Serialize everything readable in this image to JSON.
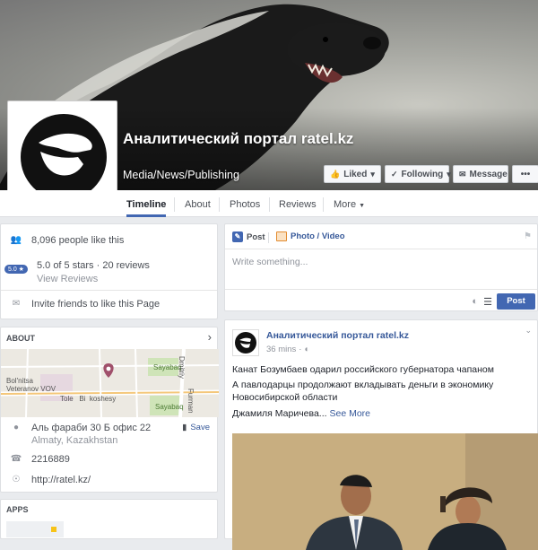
{
  "page": {
    "name": "Аналитический портал ratel.kz",
    "category": "Media/News/Publishing"
  },
  "cover_buttons": {
    "liked": "Liked",
    "following": "Following",
    "message": "Message",
    "more": "•••"
  },
  "tabs": [
    "Timeline",
    "About",
    "Photos",
    "Reviews",
    "More"
  ],
  "stats": {
    "likes": "8,096 people like this",
    "rating_badge": "5.0",
    "rating": "5.0 of 5 stars · 20 reviews",
    "view_reviews": "View Reviews",
    "invite": "Invite friends to like this Page"
  },
  "about": {
    "title": "ABOUT",
    "address_line1": "Аль фараби 30 Б офис 22",
    "address_line2": "Almaty, Kazakhstan",
    "save": "Save",
    "phone": "2216889",
    "website": "http://ratel.kz/",
    "map_labels": {
      "hospital": "Bol'nitsa\nVeteranov VOV",
      "road": "Tole   Bi  koshesy",
      "sayabaq1": "Sayabaq",
      "sayabaq2": "Sayabaq",
      "dmitriy": "Dmitriy",
      "furman": "Furman"
    }
  },
  "apps": {
    "title": "APPS"
  },
  "composer": {
    "post_tab": "Post",
    "photo_tab": "Photo / Video",
    "placeholder": "Write something...",
    "post_button": "Post"
  },
  "feed_post": {
    "author": "Аналитический портал ratel.kz",
    "time": "36 mins",
    "line1": "Канат Бозумбаев одарил российского губернатора чапаном",
    "line2": "А павлодарцы продолжают вкладывать деньги в экономику",
    "line3": "Новосибирской области",
    "line4": "Джамиля Маричева...",
    "see_more": "See More"
  },
  "colors": {
    "brand_blue": "#4267b2",
    "link": "#365899",
    "background": "#e9ebee"
  }
}
